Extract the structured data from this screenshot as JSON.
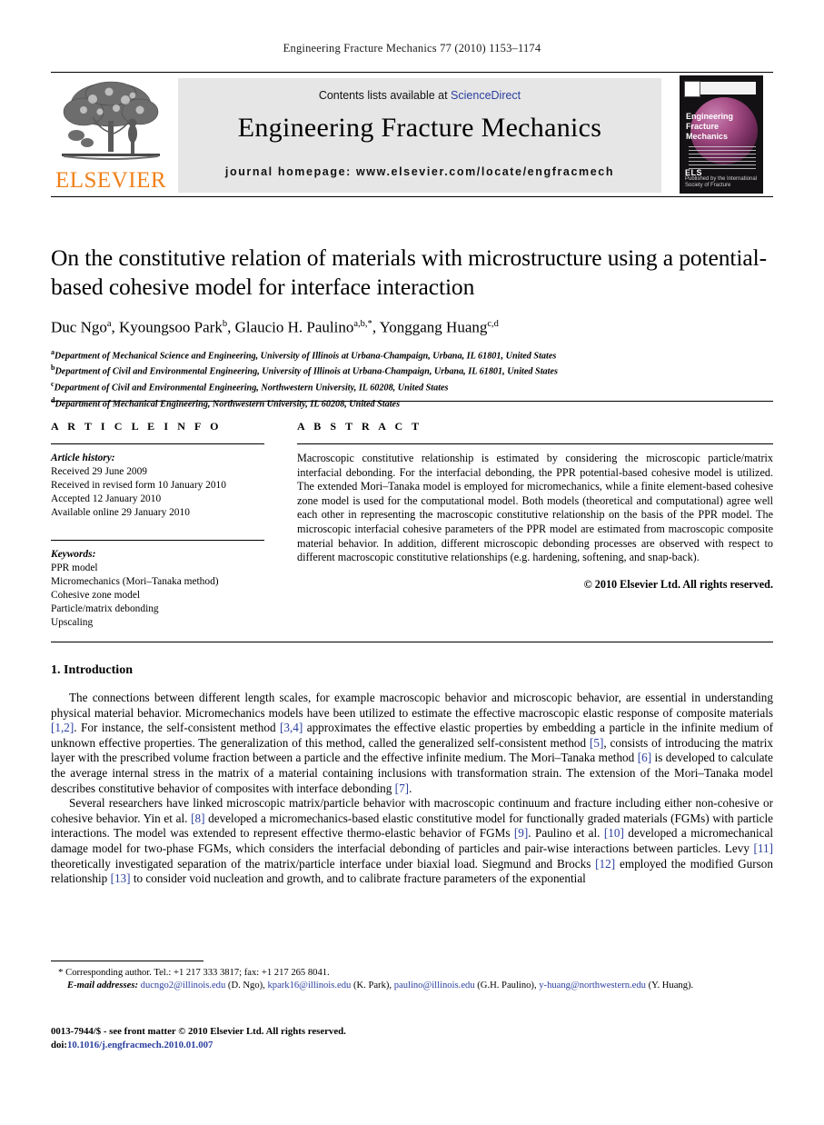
{
  "running_head": "Engineering Fracture Mechanics 77 (2010) 1153–1174",
  "masthead": {
    "contents_prefix": "Contents lists available at ",
    "sciencedirect": "ScienceDirect",
    "journal_title": "Engineering Fracture Mechanics",
    "homepage": "journal homepage: www.elsevier.com/locate/engfracmech",
    "publisher_wordmark": "ELSEVIER",
    "cover": {
      "title_line1": "Engineering",
      "title_line2": "Fracture Mechanics",
      "footer_logo": "ELS",
      "footer_text": "Published by the International Society of Fracture"
    }
  },
  "article": {
    "title": "On the constitutive relation of materials with microstructure using a potential-based cohesive model for interface interaction",
    "authors_html": "Duc Ngo<sup>a</sup>, Kyoungsoo Park<sup>b</sup>, Glaucio H. Paulino<sup>a,b,*</sup>, Yonggang Huang<sup>c,d</sup>",
    "affiliations": [
      {
        "label": "a",
        "text": "Department of Mechanical Science and Engineering, University of Illinois at Urbana-Champaign, Urbana, IL 61801, United States"
      },
      {
        "label": "b",
        "text": "Department of Civil and Environmental Engineering, University of Illinois at Urbana-Champaign, Urbana, IL 61801, United States"
      },
      {
        "label": "c",
        "text": "Department of Civil and Environmental Engineering, Northwestern University, IL 60208, United States"
      },
      {
        "label": "d",
        "text": "Department of Mechanical Engineering, Northwestern University, IL 60208, United States"
      }
    ]
  },
  "article_info": {
    "heading": "A R T I C L E   I N F O",
    "history_label": "Article history:",
    "history": [
      "Received 29 June 2009",
      "Received in revised form 10 January 2010",
      "Accepted 12 January 2010",
      "Available online 29 January 2010"
    ],
    "keywords_label": "Keywords:",
    "keywords": [
      "PPR model",
      "Micromechanics (Mori–Tanaka method)",
      "Cohesive zone model",
      "Particle/matrix debonding",
      "Upscaling"
    ]
  },
  "abstract": {
    "heading": "A B S T R A C T",
    "text": "Macroscopic constitutive relationship is estimated by considering the microscopic particle/matrix interfacial debonding. For the interfacial debonding, the PPR potential-based cohesive model is utilized. The extended Mori–Tanaka model is employed for micromechanics, while a finite element-based cohesive zone model is used for the computational model. Both models (theoretical and computational) agree well each other in representing the macroscopic constitutive relationship on the basis of the PPR model. The microscopic interfacial cohesive parameters of the PPR model are estimated from macroscopic composite material behavior. In addition, different microscopic debonding processes are observed with respect to different macroscopic constitutive relationships (e.g. hardening, softening, and snap-back).",
    "copyright": "© 2010 Elsevier Ltd. All rights reserved."
  },
  "body": {
    "section_number": "1.",
    "section_title": "Introduction",
    "paragraph1_html": "The connections between different length scales, for example macroscopic behavior and microscopic behavior, are essential in understanding physical material behavior. Micromechanics models have been utilized to estimate the effective macroscopic elastic response of composite materials <span class=\"cite\">[1,2]</span>. For instance, the self-consistent method <span class=\"cite\">[3,4]</span> approximates the effective elastic properties by embedding a particle in the infinite medium of unknown effective properties. The generalization of this method, called the generalized self-consistent method <span class=\"cite\">[5]</span>, consists of introducing the matrix layer with the prescribed volume fraction between a particle and the effective infinite medium. The Mori–Tanaka method <span class=\"cite\">[6]</span> is developed to calculate the average internal stress in the matrix of a material containing inclusions with transformation strain. The extension of the Mori–Tanaka model describes constitutive behavior of composites with interface debonding <span class=\"cite\">[7]</span>.",
    "paragraph2_html": "Several researchers have linked microscopic matrix/particle behavior with macroscopic continuum and fracture including either non-cohesive or cohesive behavior. Yin et al. <span class=\"cite\">[8]</span> developed a micromechanics-based elastic constitutive model for functionally graded materials (FGMs) with particle interactions. The model was extended to represent effective thermo-elastic behavior of FGMs <span class=\"cite\">[9]</span>. Paulino et al. <span class=\"cite\">[10]</span> developed a micromechanical damage model for two-phase FGMs, which considers the interfacial debonding of particles and pair-wise interactions between particles. Levy <span class=\"cite\">[11]</span> theoretically investigated separation of the matrix/particle interface under biaxial load. Siegmund and Brocks <span class=\"cite\">[12]</span> employed the modified Gurson relationship <span class=\"cite\">[13]</span> to consider void nucleation and growth, and to calibrate fracture parameters of the exponential"
  },
  "footnotes": {
    "corresponding_html": "<span style=\"font-size:11px\">*</span> Corresponding author. Tel.: +1 217 333 3817; fax: +1 217 265 8041.",
    "email_html": "<i>E-mail addresses:</i> <span class=\"link\">ducngo2@illinois.edu</span> (D. Ngo), <span class=\"link\">kpark16@illinois.edu</span> (K. Park), <span class=\"link\">paulino@illinois.edu</span> (G.H. Paulino), <span class=\"link\">y-huang@northwestern.edu</span> (Y. Huang)."
  },
  "imprint": {
    "line1": "0013-7944/$ - see front matter © 2010 Elsevier Ltd. All rights reserved.",
    "doi_label": "doi:",
    "doi_value": "10.1016/j.engfracmech.2010.01.007"
  }
}
